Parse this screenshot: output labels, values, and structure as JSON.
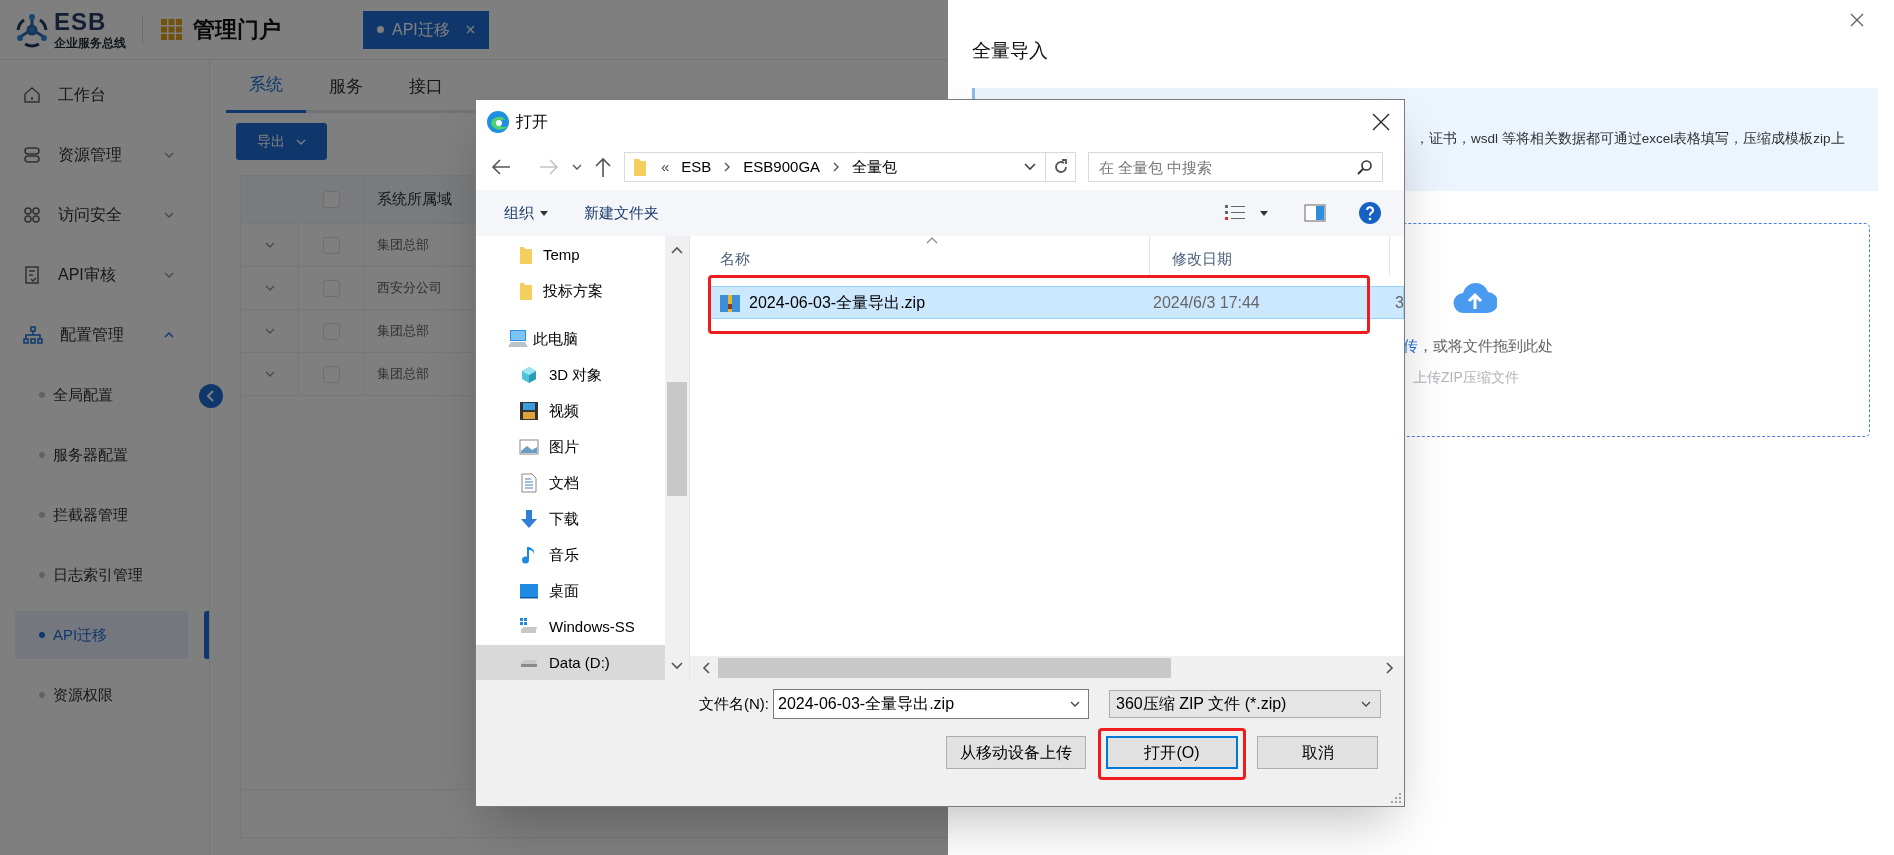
{
  "header": {
    "logo_title": "ESB",
    "logo_subtitle": "企业服务总线",
    "portal_title": "管理门户",
    "tabs": [
      {
        "label": "API迁移",
        "selected": true
      }
    ]
  },
  "sidebar": {
    "items": [
      {
        "label": "工作台"
      },
      {
        "label": "资源管理",
        "expanded": false
      },
      {
        "label": "访问安全",
        "expanded": false
      },
      {
        "label": "API审核",
        "expanded": false
      },
      {
        "label": "配置管理",
        "expanded": true,
        "children": [
          {
            "label": "全局配置",
            "selected": false
          },
          {
            "label": "服务器配置",
            "selected": false
          },
          {
            "label": "拦截器管理",
            "selected": false
          },
          {
            "label": "日志索引管理",
            "selected": false
          },
          {
            "label": "API迁移",
            "selected": true
          },
          {
            "label": "资源权限",
            "selected": false
          }
        ]
      }
    ]
  },
  "main": {
    "tabs": [
      {
        "label": "系统",
        "selected": true
      },
      {
        "label": "服务",
        "selected": false
      },
      {
        "label": "接口",
        "selected": false
      }
    ],
    "export_button": "导出",
    "table": {
      "columns": [
        "系统所属域"
      ],
      "header_checked": false,
      "rows": [
        {
          "cells": [
            "集团总部"
          ],
          "checked": false
        },
        {
          "cells": [
            "西安分公司"
          ],
          "checked": false
        },
        {
          "cells": [
            "集团总部"
          ],
          "checked": false
        },
        {
          "cells": [
            "集团总部"
          ],
          "checked": false
        }
      ]
    }
  },
  "drawer": {
    "title": "全量导入",
    "info_text": "，证书，wsdl 等将相关数据都可通过excel表格填写，压缩成模板zip上",
    "upload": {
      "link": "传",
      "text": "，或将文件拖到此处",
      "hint": "上传ZIP压缩文件"
    }
  },
  "dialog": {
    "title": "打开",
    "path_overflow": "«",
    "path": [
      "ESB",
      "ESB900GA",
      "全量包"
    ],
    "search_placeholder": "在 全量包 中搜索",
    "toolbar": {
      "organize": "组织",
      "new_folder": "新建文件夹"
    },
    "quick_access": [
      {
        "label": "Temp",
        "selected": false
      },
      {
        "label": "投标方案",
        "selected": false
      }
    ],
    "this_pc": {
      "label": "此电脑",
      "children": [
        {
          "label": "3D 对象",
          "selected": false
        },
        {
          "label": "视频",
          "selected": false
        },
        {
          "label": "图片",
          "selected": false
        },
        {
          "label": "文档",
          "selected": false
        },
        {
          "label": "下载",
          "selected": false
        },
        {
          "label": "音乐",
          "selected": false
        },
        {
          "label": "桌面",
          "selected": false
        },
        {
          "label": "Windows-SS",
          "selected": false
        },
        {
          "label": "Data (D:)",
          "selected": true
        }
      ]
    },
    "columns": [
      "名称",
      "修改日期"
    ],
    "files": [
      {
        "name": "2024-06-03-全量导出.zip",
        "modified": "2024/6/3 17:44",
        "column_3": "3",
        "selected": true,
        "highlighted": true
      }
    ],
    "filename_label": "文件名(N):",
    "filename": "2024-06-03-全量导出.zip",
    "filetype": "360压缩 ZIP 文件 (*.zip)",
    "buttons": [
      {
        "label": "从移动设备上传",
        "kind": "plain",
        "highlighted": false
      },
      {
        "label": "打开(O)",
        "kind": "default",
        "highlighted": true
      },
      {
        "label": "取消",
        "kind": "plain",
        "highlighted": false
      }
    ]
  }
}
